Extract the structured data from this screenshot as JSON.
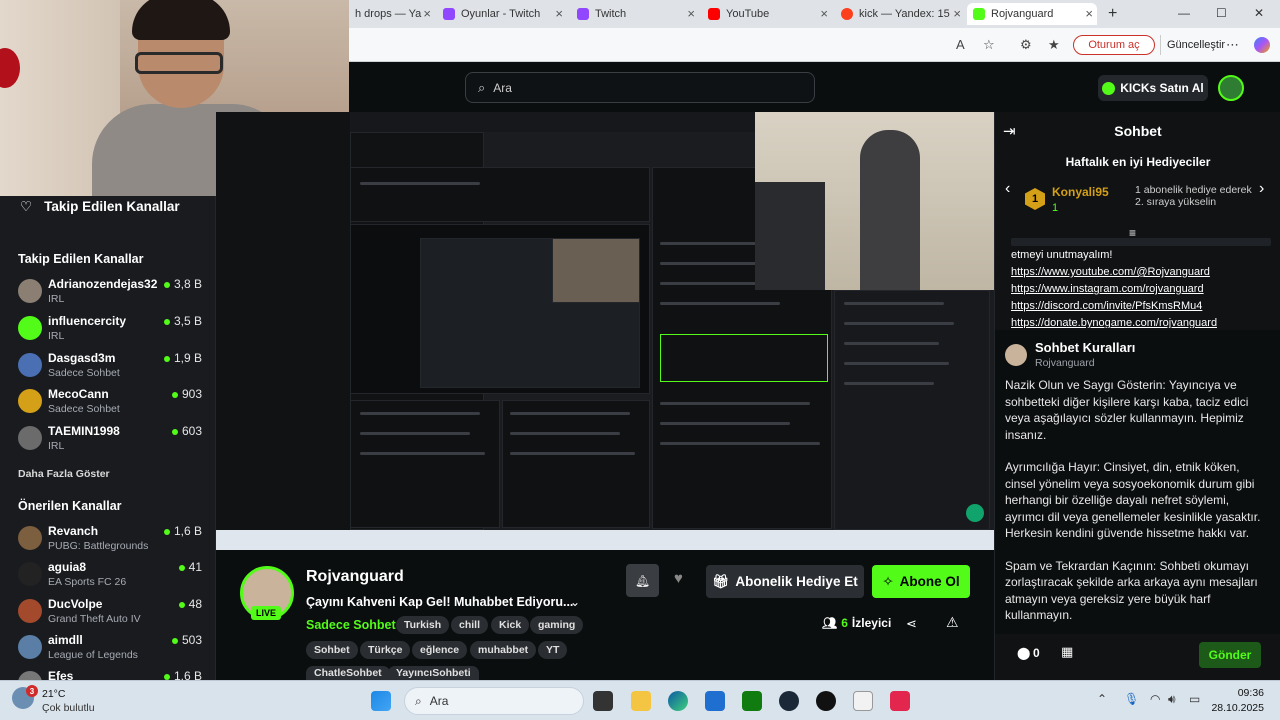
{
  "browser": {
    "tabs": [
      {
        "label": "h drops — Ya",
        "color": "#3d6ad6"
      },
      {
        "label": "Oyunlar - Twitch",
        "color": "#9146ff"
      },
      {
        "label": "Twitch",
        "color": "#9146ff"
      },
      {
        "label": "YouTube",
        "color": "#ff0000"
      },
      {
        "label": "kick — Yandex: 15",
        "color": "#fc3f1d"
      },
      {
        "label": "Rojvanguard",
        "color": "#53fc18"
      }
    ],
    "new_tab": "+",
    "signin_label": "Oturum aç",
    "update_label": "Güncelleştir"
  },
  "header": {
    "search_placeholder": "Ara",
    "kicks_button": "KICKs Satın Al"
  },
  "sidebar": {
    "followed_title": "Takip Edilen Kanallar",
    "followed_section": "Takip Edilen Kanallar",
    "followed": [
      {
        "name": "Adrianozendejas32",
        "category": "IRL",
        "viewers": "3,8 B",
        "color": "#8a7f72"
      },
      {
        "name": "influencercity",
        "category": "IRL",
        "viewers": "3,5 B",
        "color": "#53fc18"
      },
      {
        "name": "Dasgasd3m",
        "category": "Sadece Sohbet",
        "viewers": "1,9 B",
        "color": "#4a6fb3"
      },
      {
        "name": "MecoCann",
        "category": "Sadece Sohbet",
        "viewers": "903",
        "color": "#d4a017"
      },
      {
        "name": "TAEMIN1998",
        "category": "IRL",
        "viewers": "603",
        "color": "#6b6b6b"
      }
    ],
    "show_more": "Daha Fazla Göster",
    "recommended_section": "Önerilen Kanallar",
    "recommended": [
      {
        "name": "Revanch",
        "category": "PUBG: Battlegrounds",
        "viewers": "1,6 B",
        "color": "#7b5f3e"
      },
      {
        "name": "aguia8",
        "category": "EA Sports FC 26",
        "viewers": "41",
        "color": "#222222"
      },
      {
        "name": "DucVolpe",
        "category": "Grand Theft Auto IV",
        "viewers": "48",
        "color": "#a3492c"
      },
      {
        "name": "aimdll",
        "category": "League of Legends",
        "viewers": "503",
        "color": "#5a7ea6"
      },
      {
        "name": "Efes",
        "category": "",
        "viewers": "1,6 B",
        "color": "#777777"
      }
    ]
  },
  "stream": {
    "channel": "Rojvanguard",
    "title": "Çayını Kahveni Kap Gel! Muhabbet Ediyoru...",
    "live_badge": "LIVE",
    "category": "Sadece Sohbet",
    "tags_row1": [
      "Turkish",
      "chill",
      "Kick",
      "gaming"
    ],
    "tags_row2": [
      "Sohbet",
      "Türkçe",
      "eğlence",
      "muhabbet",
      "YT"
    ],
    "tags_row3": [
      "ChatleSohbet",
      "YayıncıSohbeti"
    ],
    "gift_button": "Abonelik Hediye Et",
    "subscribe_button": "Abone Ol",
    "viewers_count": "6",
    "viewers_label": "İzleyici"
  },
  "chat": {
    "title": "Sohbet",
    "gifters_title": "Haftalık en iyi Hediyeciler",
    "top_gifter": {
      "rank": "1",
      "name": "Konyali95",
      "count": "1"
    },
    "gifter_note": "1 abonelik hediye ederek 2. sıraya yükselin",
    "message_tail": "etmeyi unutmayalım!",
    "links": [
      "https://www.youtube.com/@Rojvanguard",
      "https://www.instagram.com/rojvanguard",
      "https://discord.com/invite/PfsKmsRMu4",
      "https://donate.bynogame.com/rojvanguard"
    ],
    "rules_title": "Sohbet Kuralları",
    "rules_author": "Rojvanguard",
    "rules_p1": "Nazik Olun ve Saygı Gösterin: Yayıncıya ve sohbetteki diğer kişilere karşı kaba, taciz edici veya aşağılayıcı sözler kullanmayın. Hepimiz insanız.",
    "rules_p2": "Ayrımcılığa Hayır: Cinsiyet, din, etnik köken, cinsel yönelim veya sosyoekonomik durum gibi herhangi bir özelliğe dayalı nefret söylemi, ayrımcı dil veya genellemeler kesinlikle yasaktır. Herkesin kendini güvende hissetme hakkı var.",
    "rules_p3": "Spam ve Tekrardan Kaçının: Sohbeti okumayı zorlaştıracak şekilde arka arkaya aynı mesajları atmayın veya gereksiz yere büyük harf kullanmayın.",
    "points": "0",
    "send_button": "Gönder"
  },
  "taskbar": {
    "weather_temp": "21°C",
    "weather_desc": "Çok bulutlu",
    "weather_badge": "3",
    "search_label": "Ara",
    "time": "09:36",
    "date": "28.10.2025"
  },
  "colors": {
    "kick_green": "#53fc18",
    "bg": "#0b0e0f",
    "panel": "#191b1f"
  }
}
